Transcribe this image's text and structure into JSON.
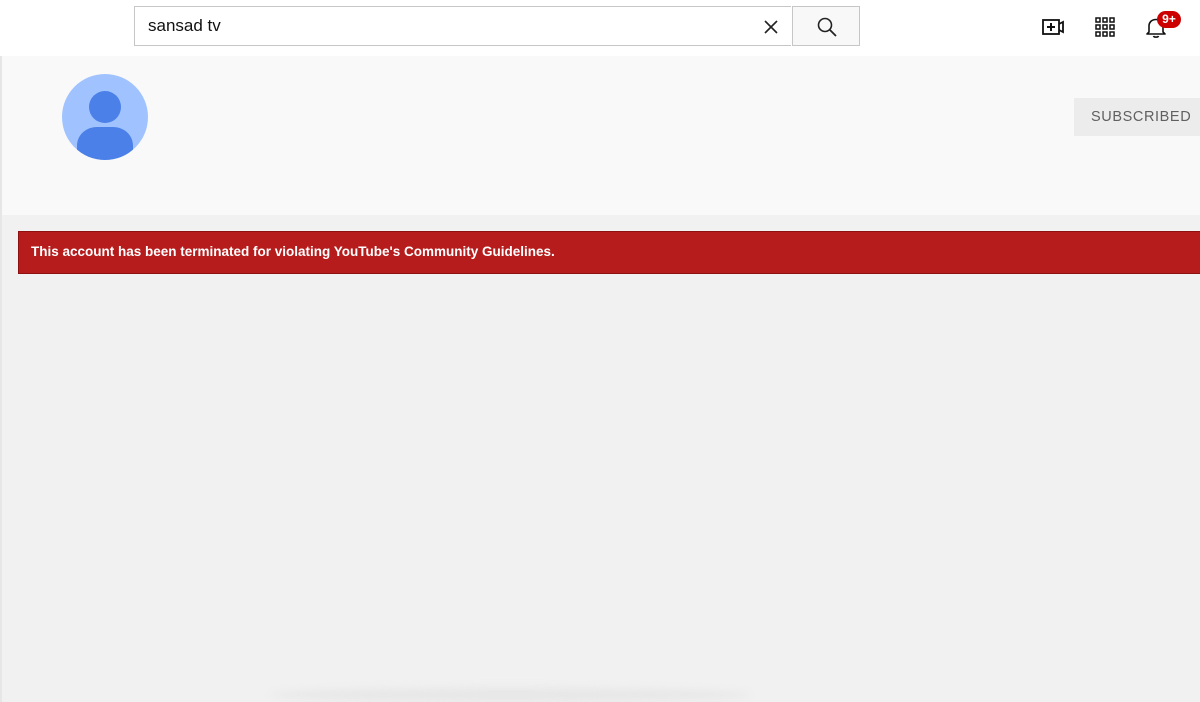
{
  "search": {
    "value": "sansad tv",
    "clear_icon": "close-icon",
    "button_icon": "search-icon"
  },
  "topbar": {
    "icons": [
      "video-create-icon",
      "apps-grid-icon",
      "bell-icon"
    ],
    "notifications_badge": "9+"
  },
  "channel": {
    "avatar_icon": "default-avatar-icon",
    "subscribe_label": "SUBSCRIBED"
  },
  "banner": {
    "message": "This account has been terminated for violating YouTube's Community Guidelines."
  },
  "colors": {
    "banner_red": "#b71c1c",
    "badge_red": "#cc0000",
    "avatar_light": "#a0c3ff",
    "avatar_dark": "#4285f4",
    "page_background": "#f1f1f1"
  }
}
